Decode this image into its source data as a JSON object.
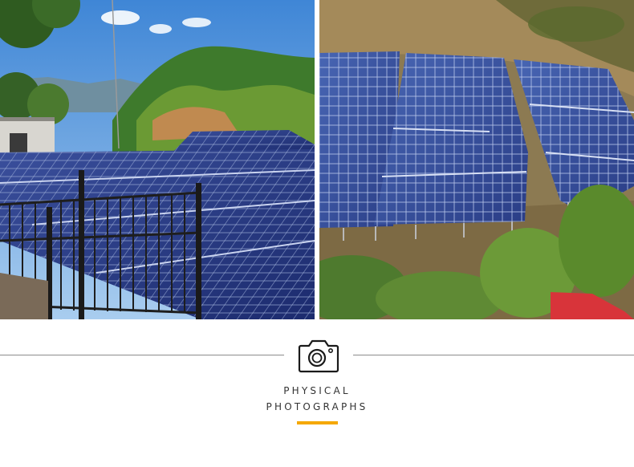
{
  "photos": [
    {
      "subject": "solar-panels-with-railing"
    },
    {
      "subject": "solar-panels-on-hillside"
    }
  ],
  "caption": {
    "icon": "camera-icon",
    "line1": "PHYSICAL",
    "line2": "PHOTOGRAPHS"
  },
  "colors": {
    "accent": "#f5a800",
    "divider": "#8c8c8c",
    "caption_text": "#333333"
  }
}
